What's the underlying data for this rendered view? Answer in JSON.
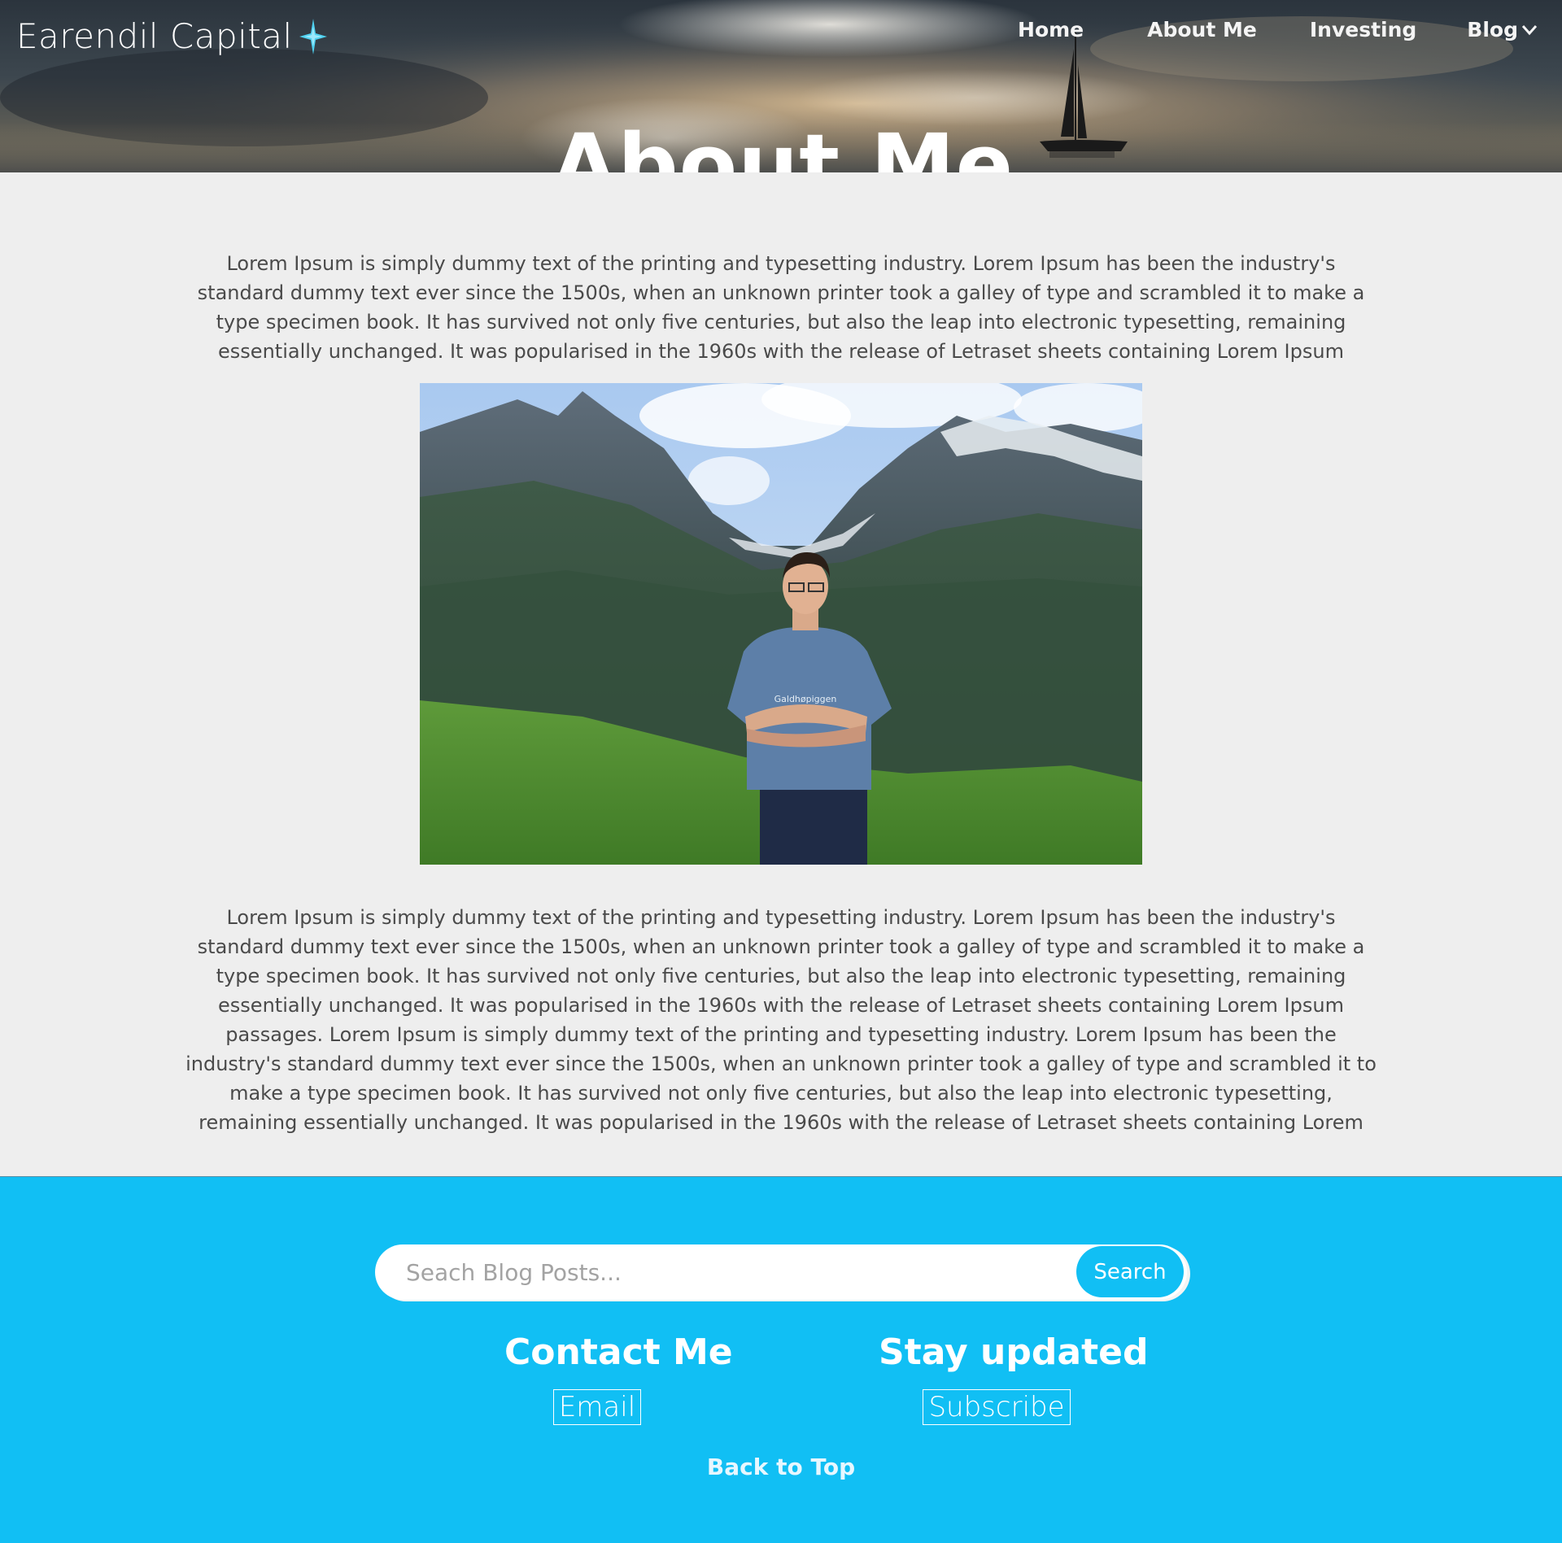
{
  "header": {
    "brand": "Earendil Capital",
    "title": "About Me",
    "nav": [
      {
        "label": "Home"
      },
      {
        "label": "About Me"
      },
      {
        "label": "Investing"
      },
      {
        "label": "Blog"
      }
    ]
  },
  "main": {
    "paragraph1": "Lorem Ipsum is simply dummy text of the printing and typesetting industry. Lorem Ipsum has been the industry's standard dummy text ever since the 1500s, when an unknown printer took a galley of type and scrambled it to make a type specimen book. It has survived not only five centuries, but also the leap into electronic typesetting, remaining essentially unchanged. It was popularised in the 1960s with the release of Letraset sheets containing Lorem Ipsum",
    "paragraph2": "Lorem Ipsum is simply dummy text of the printing and typesetting industry. Lorem Ipsum has been the industry's standard dummy text ever since the 1500s, when an unknown printer took a galley of type and scrambled it to make a type specimen book. It has survived not only five centuries, but also the leap into electronic typesetting, remaining essentially unchanged. It was popularised in the 1960s with the release of Letraset sheets containing Lorem Ipsum passages. Lorem Ipsum is simply dummy text of the printing and typesetting industry. Lorem Ipsum has been the industry's standard dummy text ever since the 1500s, when an unknown printer took a galley of type and scrambled it to make a type specimen book. It has survived not only five centuries, but also the leap into electronic typesetting, remaining essentially unchanged. It was popularised in the 1960s with the release of Letraset sheets containing Lorem",
    "shirt_text": "Galdhøpiggen"
  },
  "footer": {
    "search_placeholder": "Seach Blog Posts...",
    "search_button": "Search",
    "contact_heading": "Contact Me",
    "contact_link": "Email",
    "stay_heading": "Stay updated",
    "stay_link": "Subscribe",
    "back_to_top": "Back to Top"
  },
  "colors": {
    "footer_bg": "#11bff4",
    "page_bg": "#eeeeee",
    "body_text": "#4a4a4a",
    "star_accent": "#4fd1f0"
  },
  "icons": {
    "brand": "north-star-icon",
    "blog_dropdown": "chevron-down-icon"
  }
}
